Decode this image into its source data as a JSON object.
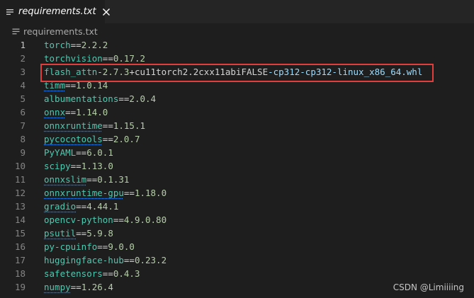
{
  "tab": {
    "label": "requirements.txt",
    "file_icon": "file-lines-icon",
    "close_icon": "close-icon"
  },
  "breadcrumb": {
    "label": "requirements.txt",
    "icon": "file-lines-icon"
  },
  "editor": {
    "active_line": 1,
    "lines": [
      {
        "n": "1",
        "pkg": "torch",
        "op": "==",
        "ver": "2.2.2"
      },
      {
        "n": "2",
        "pkg": "torchvision",
        "op": "==",
        "ver": "0.17.2"
      },
      {
        "n": "3",
        "pkg": "flash_attn",
        "op": "-",
        "ver": "2.7.3",
        "tag": "+cu11torch2.2cxx11abiFALSE",
        "plat": "-cp312-cp312-linux_x86_64.whl"
      },
      {
        "n": "4",
        "pkg": "timm",
        "op": "==",
        "ver": "1.0.14"
      },
      {
        "n": "5",
        "pkg": "albumentations",
        "op": "==",
        "ver": "2.0.4"
      },
      {
        "n": "6",
        "pkg": "onnx",
        "op": "==",
        "ver": "1.14.0"
      },
      {
        "n": "7",
        "pkg": "onnxruntime",
        "op": "==",
        "ver": "1.15.1"
      },
      {
        "n": "8",
        "pkg": "pycocotools",
        "op": "==",
        "ver": "2.0.7"
      },
      {
        "n": "9",
        "pkg": "PyYAML",
        "op": "==",
        "ver": "6.0.1"
      },
      {
        "n": "10",
        "pkg": "scipy",
        "op": "==",
        "ver": "1.13.0"
      },
      {
        "n": "11",
        "pkg": "onnxslim",
        "op": "==",
        "ver": "0.1.31"
      },
      {
        "n": "12",
        "pkg": "onnxruntime-gpu",
        "op": "==",
        "ver": "1.18.0"
      },
      {
        "n": "13",
        "pkg": "gradio",
        "op": "==",
        "ver": "4.44.1"
      },
      {
        "n": "14",
        "pkg": "opencv-python",
        "op": "==",
        "ver": "4.9.0.80"
      },
      {
        "n": "15",
        "pkg": "psutil",
        "op": "==",
        "ver": "5.9.8"
      },
      {
        "n": "16",
        "pkg": "py-cpuinfo",
        "op": "==",
        "ver": "9.0.0"
      },
      {
        "n": "17",
        "pkg": "huggingface-hub",
        "op": "==",
        "ver": "0.23.2"
      },
      {
        "n": "18",
        "pkg": "safetensors",
        "op": "==",
        "ver": "0.4.3"
      },
      {
        "n": "19",
        "pkg": "numpy",
        "op": "==",
        "ver": "1.26.4"
      }
    ]
  },
  "watermark": "CSDN @Limiiiing",
  "colors": {
    "background": "#1e1e1e",
    "package": "#4ec9b0",
    "version": "#b5cea8",
    "highlight_border": "#e03d3d"
  }
}
